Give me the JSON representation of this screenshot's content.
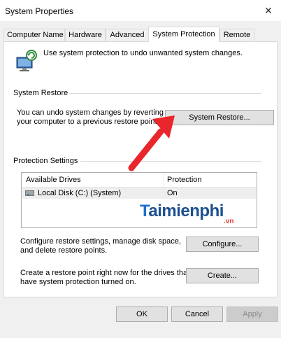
{
  "window": {
    "title": "System Properties",
    "close_glyph": "✕"
  },
  "tabs": [
    {
      "label": "Computer Name"
    },
    {
      "label": "Hardware"
    },
    {
      "label": "Advanced"
    },
    {
      "label": "System Protection",
      "active": true
    },
    {
      "label": "Remote"
    }
  ],
  "intro": {
    "icon": "system-protection-icon",
    "text": "Use system protection to undo unwanted system changes."
  },
  "system_restore": {
    "heading": "System Restore",
    "description_line1": "You can undo system changes by reverting",
    "description_line2": "your computer to a previous restore point.",
    "button_label": "System Restore..."
  },
  "protection_settings": {
    "heading": "Protection Settings",
    "columns": [
      "Available Drives",
      "Protection"
    ],
    "rows": [
      {
        "drive": "Local Disk (C:) (System)",
        "protection": "On",
        "icon": "hard-drive-icon"
      }
    ],
    "configure_line1": "Configure restore settings, manage disk space,",
    "configure_line2": "and delete restore points.",
    "configure_label": "Configure...",
    "create_line1": "Create a restore point right now for the drives that",
    "create_line2": "have system protection turned on.",
    "create_label": "Create..."
  },
  "footer": {
    "ok_label": "OK",
    "cancel_label": "Cancel",
    "apply_label": "Apply"
  },
  "watermark": {
    "brand_initial": "T",
    "brand_rest": "aimienphi",
    "suffix": ".vn"
  },
  "colors": {
    "accent_arrow": "#e8262b",
    "watermark": "#1d4f91",
    "watermark_suffix": "#e53935"
  }
}
